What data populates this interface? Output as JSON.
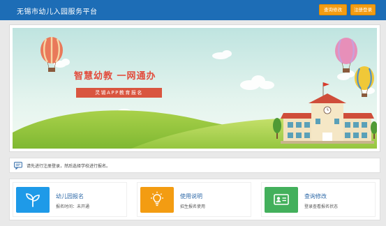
{
  "header": {
    "title": "无锡市幼儿入园服务平台",
    "query_button": "查询修改",
    "login_button": "注册登录"
  },
  "banner": {
    "slogan": "智慧幼教  一网通办",
    "subtitle": "灵锡APP教育报名"
  },
  "notice": {
    "icon": "message-icon",
    "text": "请先进行注册登录，然后选择学校进行报名。"
  },
  "cards": [
    {
      "title": "幼儿园报名",
      "desc": "报名时间：未开通",
      "icon": "sprout-icon",
      "color": "#1e9ae8"
    },
    {
      "title": "使用说明",
      "desc": "招生报名使用",
      "icon": "lightbulb-icon",
      "color": "#f39c12"
    },
    {
      "title": "查询修改",
      "desc": "登录查看报名状态",
      "icon": "id-card-icon",
      "color": "#43b05c"
    }
  ],
  "colors": {
    "header_bg": "#1d6db6",
    "accent_orange": "#f39c12",
    "slogan_red": "#e24c3c"
  }
}
